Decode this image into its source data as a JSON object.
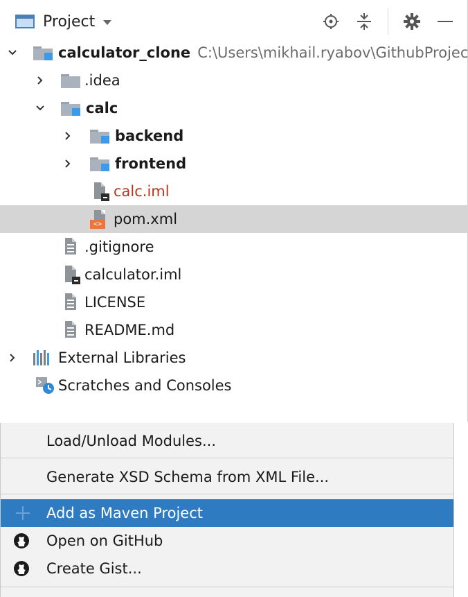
{
  "toolbar": {
    "title": "Project",
    "icons": [
      "locate-icon",
      "collapse-all-icon",
      "gear-icon",
      "minimize-icon"
    ]
  },
  "tree": {
    "root": {
      "name": "calculator_clone",
      "path": "C:\\Users\\mikhail.ryabov\\GithubProjec"
    },
    "idea": ".idea",
    "calc": "calc",
    "backend": "backend",
    "frontend": "frontend",
    "calc_iml": "calc.iml",
    "pom": "pom.xml",
    "gitignore": ".gitignore",
    "calculator_iml": "calculator.iml",
    "license": "LICENSE",
    "readme": "README.md",
    "external_libraries": "External Libraries",
    "scratches": "Scratches and Consoles"
  },
  "menu": {
    "items": [
      "Load/Unload Modules...",
      "Generate XSD Schema from XML File...",
      "Add as Maven Project",
      "Open on GitHub",
      "Create Gist..."
    ],
    "highlighted": "Add as Maven Project"
  },
  "colors": {
    "selection": "#d5d5d5",
    "menu_highlight": "#2f7bc1",
    "folder_mark": "#3d9ae8",
    "error_text": "#b5371e",
    "xml_badge": "#e9773b"
  }
}
